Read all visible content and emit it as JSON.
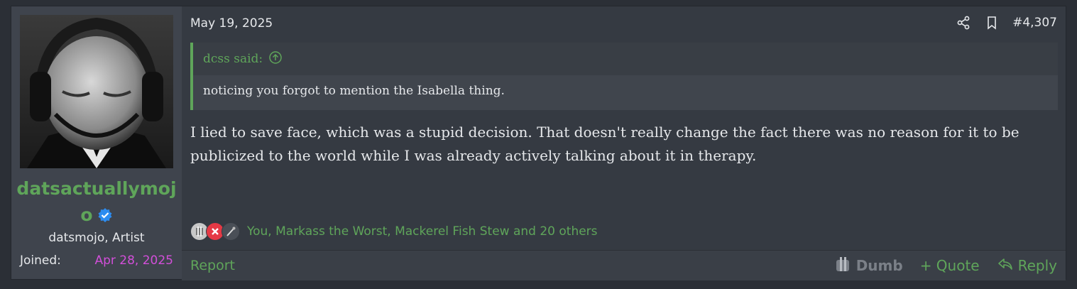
{
  "post": {
    "date": "May 19, 2025",
    "number": "#4,307",
    "author": {
      "username": "datsactuallymojo",
      "title": "datsmojo, Artist",
      "joined_label": "Joined:",
      "joined_date": "Apr 28, 2025"
    },
    "quote": {
      "author_label": "dcss said:",
      "text": "noticing you forgot to mention the Isabella thing."
    },
    "message": "I lied to save face, which was a stupid decision. That doesn't really change the fact there was no reason for it to be publicized to the world while I was already actively talking about it in therapy.",
    "reactions": {
      "icons": [
        "dumb-icon",
        "x-icon",
        "pipe-icon"
      ],
      "text": "You, Markass the Worst, Mackerel Fish Stew and 20 others"
    },
    "footer": {
      "report": "Report",
      "dumb": "Dumb",
      "quote": "+ Quote",
      "reply": "Reply"
    }
  },
  "colors": {
    "accent": "#5fa55a",
    "joined_date": "#d24fd9",
    "background": "#2b2f36",
    "post_bg": "#353a42"
  }
}
